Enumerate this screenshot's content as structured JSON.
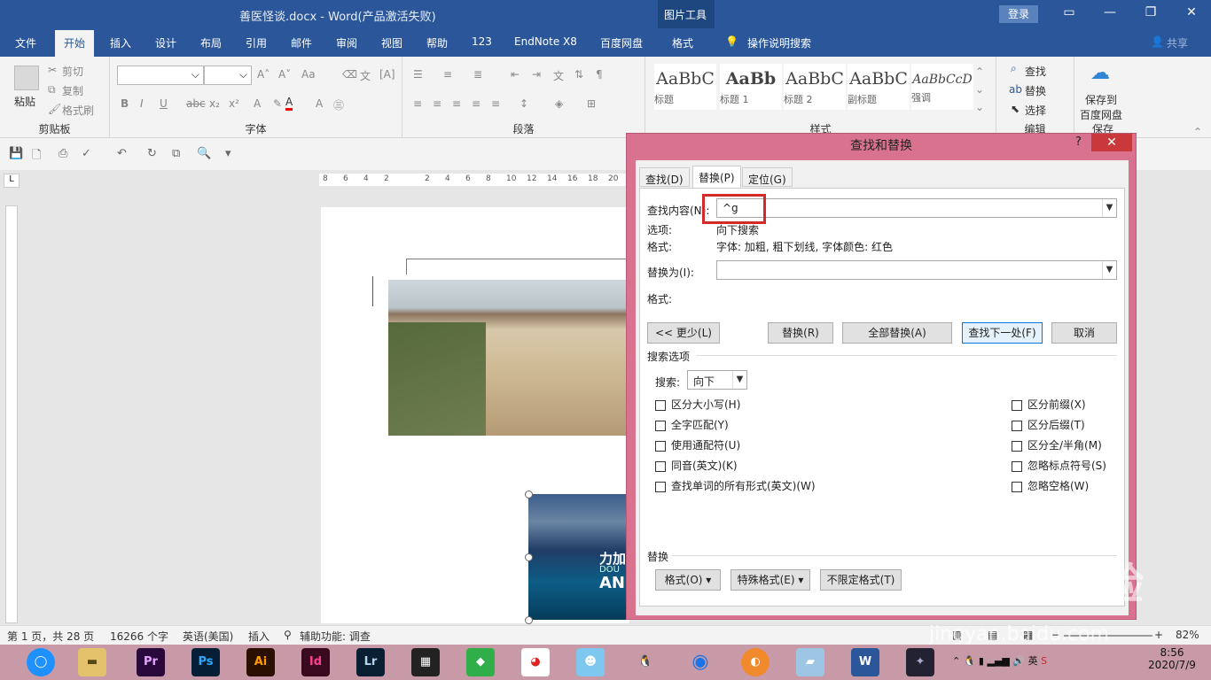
{
  "window": {
    "title": "善医怪谈.docx  -  Word(产品激活失败)",
    "picture_tools": "图片工具",
    "login": "登录"
  },
  "tabs": [
    "文件",
    "开始",
    "插入",
    "设计",
    "布局",
    "引用",
    "邮件",
    "审阅",
    "视图",
    "帮助",
    "123",
    "EndNote X8",
    "百度网盘",
    "格式"
  ],
  "tell_me": "操作说明搜索",
  "share": "共享",
  "ribbon": {
    "clipboard": {
      "label": "剪贴板",
      "paste": "粘贴",
      "cut": "剪切",
      "copy": "复制",
      "format_painter": "格式刷"
    },
    "font": {
      "label": "字体"
    },
    "paragraph": {
      "label": "段落"
    },
    "styles": {
      "label": "样式",
      "items": [
        {
          "preview": "AaBbC",
          "name": "标题"
        },
        {
          "preview": "AaBb",
          "name": "标题 1"
        },
        {
          "preview": "AaBbC",
          "name": "标题 2"
        },
        {
          "preview": "AaBbC",
          "name": "副标题"
        },
        {
          "preview": "AaBbCcD",
          "name": "强调"
        }
      ]
    },
    "editing": {
      "label": "编辑",
      "find": "查找",
      "replace": "替换",
      "select": "选择"
    },
    "save": {
      "label": "保存",
      "button": "保存到\n百度网盘"
    }
  },
  "ruler_ticks": [
    "8",
    "6",
    "4",
    "2",
    "",
    "2",
    "4",
    "6",
    "8",
    "10",
    "12",
    "14",
    "16",
    "18",
    "20"
  ],
  "image2_text": {
    "line1": "力加",
    "line2": "DOU",
    "line3": "AN"
  },
  "dialog": {
    "title": "查找和替换",
    "help": "?",
    "close": "✕",
    "tabs": [
      "查找(D)",
      "替换(P)",
      "定位(G)"
    ],
    "find_label": "查找内容(N):",
    "find_value": "^g",
    "options_label": "选项:",
    "options_value": "向下搜索",
    "format_label": "格式:",
    "format_value": "字体: 加粗, 粗下划线, 字体颜色: 红色",
    "replace_label": "替换为(I):",
    "replace_value": "",
    "replace_format_label": "格式:",
    "buttons": {
      "less": "<< 更少(L)",
      "replace": "替换(R)",
      "replace_all": "全部替换(A)",
      "find_next": "查找下一处(F)",
      "cancel": "取消"
    },
    "search_options_title": "搜索选项",
    "search_label": "搜索:",
    "search_direction": "向下",
    "left_checks": [
      "区分大小写(H)",
      "全字匹配(Y)",
      "使用通配符(U)",
      "同音(英文)(K)",
      "查找单词的所有形式(英文)(W)"
    ],
    "right_checks": [
      "区分前缀(X)",
      "区分后缀(T)",
      "区分全/半角(M)",
      "忽略标点符号(S)",
      "忽略空格(W)"
    ],
    "replace_section": "替换",
    "bottom_buttons": {
      "format": "格式(O) ▾",
      "special": "特殊格式(E) ▾",
      "no_format": "不限定格式(T)"
    }
  },
  "status": {
    "page": "第 1 页，共 28 页",
    "words": "16266 个字",
    "language": "英语(美国)",
    "insert": "插入",
    "accessibility": "辅助功能: 调查",
    "zoom": "82%"
  },
  "taskbar": {
    "apps": [
      {
        "name": "Pr",
        "color": "#2a0a3d",
        "fg": "#e7a4ff"
      },
      {
        "name": "Ps",
        "color": "#061e35",
        "fg": "#31a8ff"
      },
      {
        "name": "Ai",
        "color": "#2b1000",
        "fg": "#ff9a00"
      },
      {
        "name": "Id",
        "color": "#3a0b1f",
        "fg": "#ff3f94"
      },
      {
        "name": "Lr",
        "color": "#0b1f33",
        "fg": "#b6d4ef"
      },
      {
        "name": "W",
        "color": "#2b579a",
        "fg": "#ffffff"
      }
    ],
    "time": "8:56",
    "date": "2020/7/9",
    "ime": "英"
  },
  "watermark": {
    "logo": "Baidu经验",
    "url": "jingyan.baidu.com"
  }
}
